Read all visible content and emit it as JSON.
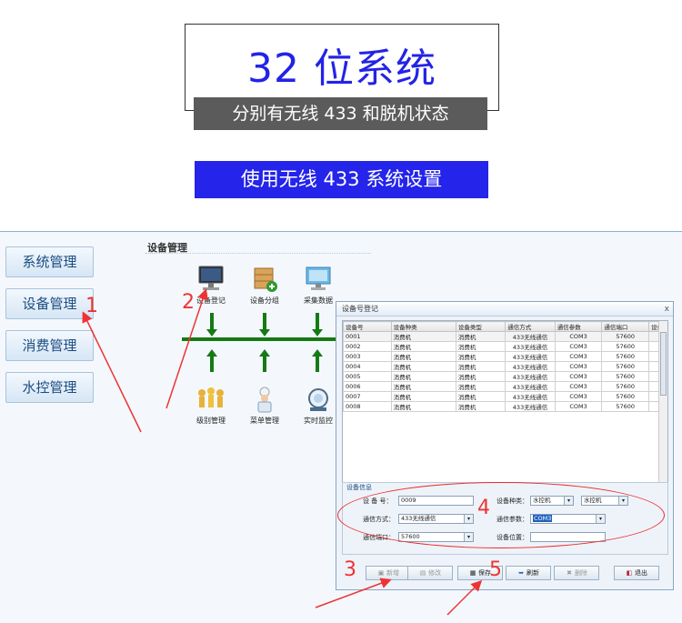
{
  "banner": {
    "title": "32 位系统",
    "subtitle": "分别有无线 433 和脱机状态",
    "blue_banner": "使用无线 433 系统设置"
  },
  "sidebar": {
    "items": [
      {
        "label": "系统管理"
      },
      {
        "label": "设备管理"
      },
      {
        "label": "消费管理"
      },
      {
        "label": "水控管理"
      }
    ]
  },
  "main": {
    "section_title": "设备管理",
    "top_icons": [
      {
        "label": "设备登记",
        "icon": "monitor-icon"
      },
      {
        "label": "设备分组",
        "icon": "box-add-icon"
      },
      {
        "label": "采集数据",
        "icon": "screen-icon"
      }
    ],
    "bottom_icons": [
      {
        "label": "级别管理",
        "icon": "people-icon"
      },
      {
        "label": "菜单管理",
        "icon": "chef-icon"
      },
      {
        "label": "实时监控",
        "icon": "magnifier-icon"
      }
    ]
  },
  "dialog": {
    "title": "设备号登记",
    "close": "x",
    "columns": [
      "设备号",
      "设备种类",
      "设备类型",
      "通信方式",
      "通信参数",
      "通信端口",
      "设备"
    ],
    "rows": [
      [
        "0001",
        "消费机",
        "消费机",
        "433无线通信",
        "COM3",
        "57600"
      ],
      [
        "0002",
        "消费机",
        "消费机",
        "433无线通信",
        "COM3",
        "57600"
      ],
      [
        "0003",
        "消费机",
        "消费机",
        "433无线通信",
        "COM3",
        "57600"
      ],
      [
        "0004",
        "消费机",
        "消费机",
        "433无线通信",
        "COM3",
        "57600"
      ],
      [
        "0005",
        "消费机",
        "消费机",
        "433无线通信",
        "COM3",
        "57600"
      ],
      [
        "0006",
        "消费机",
        "消费机",
        "433无线通信",
        "COM3",
        "57600"
      ],
      [
        "0007",
        "消费机",
        "消费机",
        "433无线通信",
        "COM3",
        "57600"
      ],
      [
        "0008",
        "消费机",
        "消费机",
        "433无线通信",
        "COM3",
        "57600"
      ]
    ],
    "info": {
      "panel_title": "设备信息",
      "device_no_label": "设 备 号：",
      "device_no_value": "0009",
      "device_kind_label": "设备种类：",
      "device_kind_value1": "水控机",
      "device_kind_value2": "水控机",
      "comm_mode_label": "通信方式：",
      "comm_mode_value": "433无线通信",
      "comm_param_label": "通信参数：",
      "comm_param_value": "COM3",
      "comm_port_label": "通信端口：",
      "comm_port_value": "57600",
      "location_label": "设备位置：",
      "location_value": ""
    },
    "buttons": {
      "new": "新增",
      "edit": "修改",
      "save": "保存",
      "refresh": "刷新",
      "delete": "删除",
      "exit": "退出"
    }
  },
  "annotations": {
    "n1": "1",
    "n2": "2",
    "n3": "3",
    "n4": "4",
    "n5": "5"
  },
  "colors": {
    "title_blue": "#2323e6",
    "banner_blue": "#2424ea",
    "subtitle_gray": "#5b5b5b",
    "annotation_red": "#ee3333",
    "arrow_green": "#157a15"
  }
}
